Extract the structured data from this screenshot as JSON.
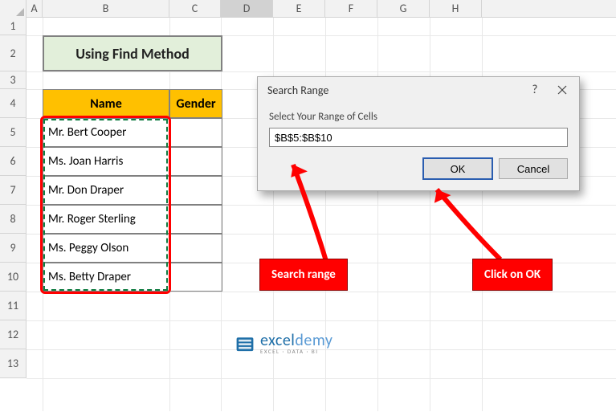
{
  "column_headers": [
    "A",
    "B",
    "C",
    "D",
    "E",
    "F",
    "G",
    "H"
  ],
  "row_headers": [
    "1",
    "2",
    "3",
    "4",
    "5",
    "6",
    "7",
    "8",
    "9",
    "10",
    "11",
    "12",
    "13"
  ],
  "title": "Using Find Method",
  "table": {
    "headers": {
      "name": "Name",
      "gender": "Gender"
    },
    "names": [
      "Mr. Bert Cooper",
      "Ms. Joan Harris",
      "Mr. Don Draper",
      "Mr. Roger Sterling",
      "Ms. Peggy Olson",
      "Ms. Betty Draper"
    ]
  },
  "dialog": {
    "title": "Search Range",
    "label": "Select Your Range of Cells",
    "value": "$B$5:$B$10",
    "ok": "OK",
    "cancel": "Cancel",
    "help": "?"
  },
  "callouts": {
    "search_range": "Search range",
    "click_ok": "Click on OK"
  },
  "logo": {
    "main1": "excel",
    "main2": "demy",
    "sub": "EXCEL · DATA · BI"
  }
}
